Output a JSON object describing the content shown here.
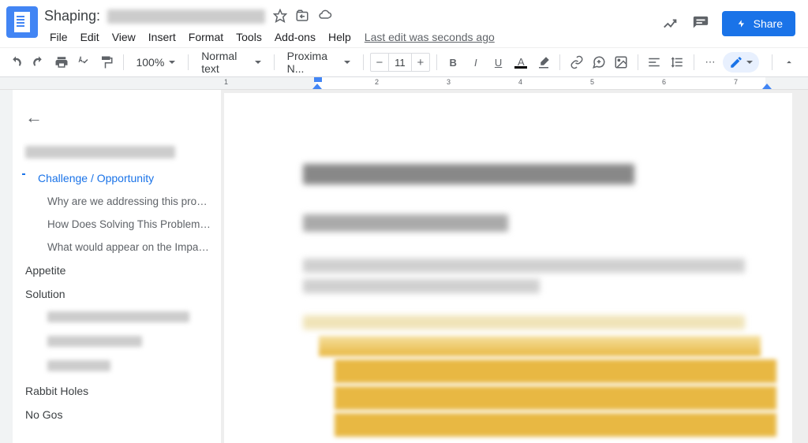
{
  "header": {
    "title_prefix": "Shaping:",
    "star_tooltip": "Star",
    "move_tooltip": "Move",
    "cloud_tooltip": "See document status",
    "last_edit": "Last edit was seconds ago",
    "share_label": "Share"
  },
  "menus": [
    "File",
    "Edit",
    "View",
    "Insert",
    "Format",
    "Tools",
    "Add-ons",
    "Help"
  ],
  "toolbar": {
    "zoom": "100%",
    "style": "Normal text",
    "font": "Proxima N...",
    "font_size": "11"
  },
  "outline": {
    "title_redacted": true,
    "items": [
      {
        "label": "Challenge / Opportunity",
        "level": 1,
        "active": true
      },
      {
        "label": "Why are we addressing this pro…",
        "level": 2
      },
      {
        "label": "How Does Solving This Problem…",
        "level": 2
      },
      {
        "label": "What would appear on the Impa…",
        "level": 2
      },
      {
        "label": "Appetite",
        "level": 1
      },
      {
        "label": "Solution",
        "level": 1
      },
      {
        "label": "Rabbit Holes",
        "level": 1
      },
      {
        "label": "No Gos",
        "level": 1
      }
    ]
  },
  "ruler": {
    "numbers": [
      "1",
      "2",
      "3",
      "4",
      "5",
      "6",
      "7"
    ]
  }
}
